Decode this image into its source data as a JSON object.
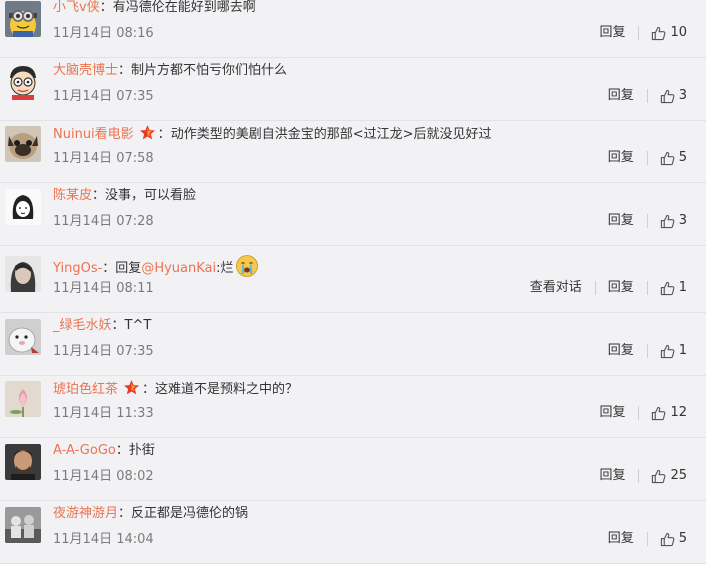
{
  "comments": [
    {
      "user": "小飞v侠",
      "vip": false,
      "text": "有冯德伦在能好到哪去啊",
      "mention": "",
      "after": "",
      "emoji": "",
      "time": "11月14日 08:16",
      "dialog": "",
      "reply": "回复",
      "likes": "10"
    },
    {
      "user": "大脑壳博士",
      "vip": false,
      "text": "制片方都不怕亏你们怕什么",
      "mention": "",
      "after": "",
      "emoji": "",
      "time": "11月14日 07:35",
      "dialog": "",
      "reply": "回复",
      "likes": "3"
    },
    {
      "user": "Nuinui看电影",
      "vip": true,
      "text": "动作类型的美剧自洪金宝的那部<过江龙>后就没见好过",
      "mention": "",
      "after": "",
      "emoji": "",
      "time": "11月14日 07:58",
      "dialog": "",
      "reply": "回复",
      "likes": "5"
    },
    {
      "user": "陈某皮",
      "vip": false,
      "text": "没事，可以看脸",
      "mention": "",
      "after": "",
      "emoji": "",
      "time": "11月14日 07:28",
      "dialog": "",
      "reply": "回复",
      "likes": "3"
    },
    {
      "user": "YingOs-",
      "vip": false,
      "text": "回复",
      "mention": "@HyuanKai",
      "after": ":烂",
      "emoji": "crying-face",
      "time": "11月14日 08:11",
      "dialog": "查看对话",
      "reply": "回复",
      "likes": "1"
    },
    {
      "user": "_绿毛水妖",
      "vip": false,
      "text": "T^T",
      "mention": "",
      "after": "",
      "emoji": "",
      "time": "11月14日 07:35",
      "dialog": "",
      "reply": "回复",
      "likes": "1"
    },
    {
      "user": "琥珀色红茶",
      "vip": true,
      "text": "这难道不是预料之中的？",
      "mention": "",
      "after": "",
      "emoji": "",
      "time": "11月14日 11:33",
      "dialog": "",
      "reply": "回复",
      "likes": "12"
    },
    {
      "user": "A-A-GoGo",
      "vip": false,
      "text": "扑街",
      "mention": "",
      "after": "",
      "emoji": "",
      "time": "11月14日 08:02",
      "dialog": "",
      "reply": "回复",
      "likes": "25"
    },
    {
      "user": "夜游神游月",
      "vip": false,
      "text": "反正都是冯德伦的锅",
      "mention": "",
      "after": "",
      "emoji": "",
      "time": "11月14日 14:04",
      "dialog": "",
      "reply": "回复",
      "likes": "5"
    }
  ],
  "colors": {
    "username": "#eb7350",
    "background": "#f2f2f5",
    "time": "#7b7b7b",
    "vip_star": "#e8392b"
  }
}
